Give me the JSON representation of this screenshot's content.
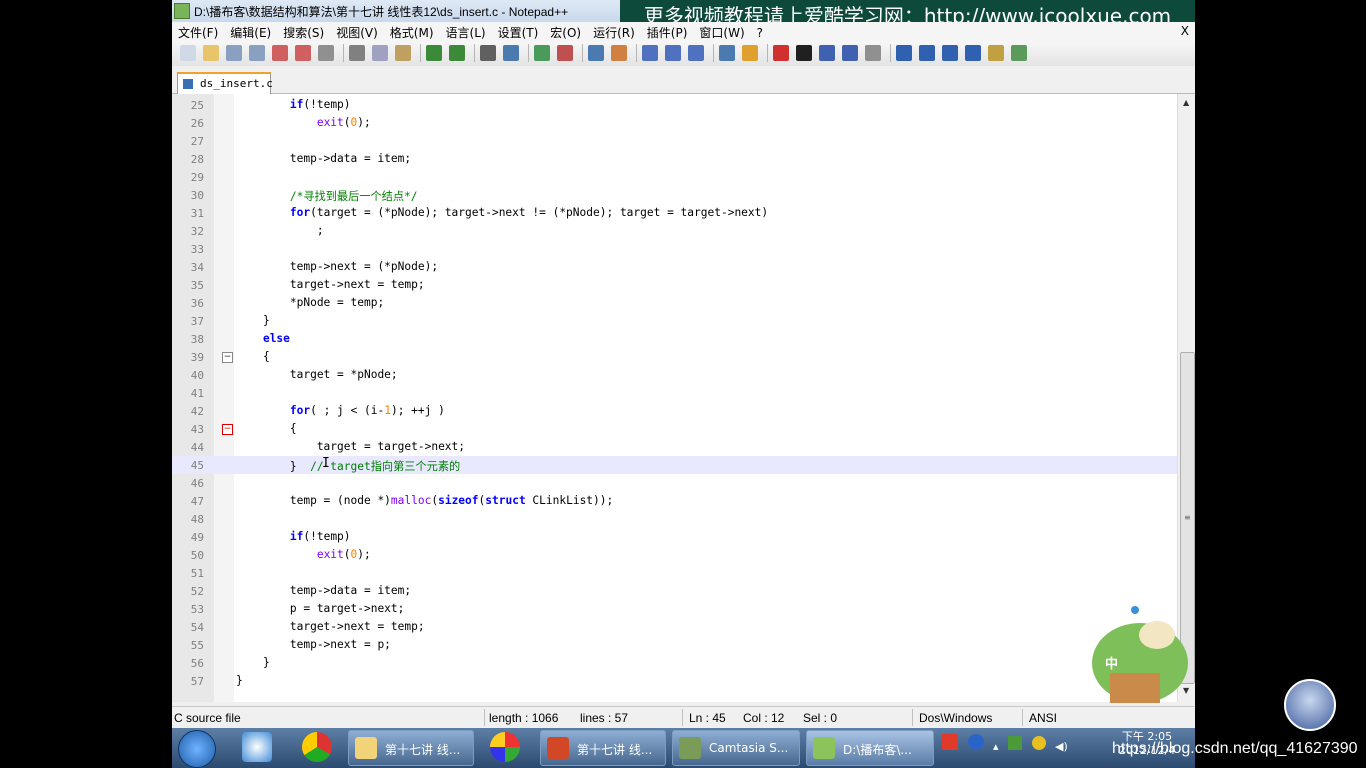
{
  "window": {
    "title": "D:\\播布客\\数据结构和算法\\第十七讲 线性表12\\ds_insert.c - Notepad++"
  },
  "watermark": "更多视频教程请上爱酷学习网：http://www.icoolxue.com",
  "menu": [
    "文件(F)",
    "编辑(E)",
    "搜索(S)",
    "视图(V)",
    "格式(M)",
    "语言(L)",
    "设置(T)",
    "宏(O)",
    "运行(R)",
    "插件(P)",
    "窗口(W)",
    "?"
  ],
  "menu_close": "X",
  "tab": {
    "label": "ds_insert.c"
  },
  "editor": {
    "lines": [
      {
        "n": "25",
        "code": "        if(!temp)"
      },
      {
        "n": "26",
        "code": "            exit(0);"
      },
      {
        "n": "27",
        "code": ""
      },
      {
        "n": "28",
        "code": "        temp->data = item;"
      },
      {
        "n": "29",
        "code": ""
      },
      {
        "n": "30",
        "code": "        /*寻找到最后一个结点*/"
      },
      {
        "n": "31",
        "code": "        for(target = (*pNode); target->next != (*pNode); target = target->next)"
      },
      {
        "n": "32",
        "code": "            ;"
      },
      {
        "n": "33",
        "code": ""
      },
      {
        "n": "34",
        "code": "        temp->next = (*pNode);"
      },
      {
        "n": "35",
        "code": "        target->next = temp;"
      },
      {
        "n": "36",
        "code": "        *pNode = temp;"
      },
      {
        "n": "37",
        "code": "    }"
      },
      {
        "n": "38",
        "code": "    else"
      },
      {
        "n": "39",
        "code": "    {"
      },
      {
        "n": "40",
        "code": "        target = *pNode;"
      },
      {
        "n": "41",
        "code": ""
      },
      {
        "n": "42",
        "code": "        for( ; j < (i-1); ++j )"
      },
      {
        "n": "43",
        "code": "        {"
      },
      {
        "n": "44",
        "code": "            target = target->next;"
      },
      {
        "n": "45",
        "code": "        }  // target指向第三个元素的"
      },
      {
        "n": "46",
        "code": ""
      },
      {
        "n": "47",
        "code": "        temp = (node *)malloc(sizeof(struct CLinkList));"
      },
      {
        "n": "48",
        "code": ""
      },
      {
        "n": "49",
        "code": "        if(!temp)"
      },
      {
        "n": "50",
        "code": "            exit(0);"
      },
      {
        "n": "51",
        "code": ""
      },
      {
        "n": "52",
        "code": "        temp->data = item;"
      },
      {
        "n": "53",
        "code": "        p = target->next;"
      },
      {
        "n": "54",
        "code": "        target->next = temp;"
      },
      {
        "n": "55",
        "code": "        temp->next = p;"
      },
      {
        "n": "56",
        "code": "    }"
      },
      {
        "n": "57",
        "code": "}"
      }
    ],
    "current_line": "45"
  },
  "status": {
    "filetype": "C source file",
    "length": "length : 1066",
    "lines": "lines : 57",
    "ln": "Ln : 45",
    "col": "Col : 12",
    "sel": "Sel : 0",
    "eol": "Dos\\Windows",
    "encoding": "ANSI"
  },
  "taskbar": {
    "buttons": [
      {
        "label": "第十七讲 线..."
      },
      {
        "label": "第十七讲 线..."
      },
      {
        "label": "Camtasia S..."
      },
      {
        "label": "D:\\播布客\\..."
      }
    ],
    "clock_time": "下午 2:05",
    "clock_date": "2012/12/4",
    "ime": "中"
  },
  "csdn_watermark": "https://blog.csdn.net/qq_41627390",
  "colors": {
    "keyword": "#0000ff",
    "type": "#8000ff",
    "number": "#ff8000",
    "comment": "#008000",
    "watermark_bg": "#0d4a3c",
    "current_line": "#e8e8ff"
  }
}
